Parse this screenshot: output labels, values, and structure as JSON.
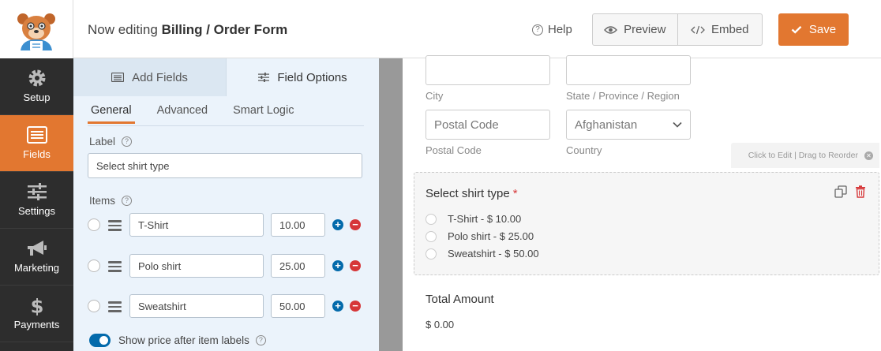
{
  "header": {
    "title_prefix": "Now editing",
    "form_name": "Billing / Order Form",
    "help_label": "Help",
    "preview_label": "Preview",
    "embed_label": "Embed",
    "save_label": "Save",
    "accent_color": "#e27730"
  },
  "nav": [
    {
      "label": "Setup",
      "icon": "gear-icon"
    },
    {
      "label": "Fields",
      "icon": "fields-icon",
      "active": true
    },
    {
      "label": "Settings",
      "icon": "sliders-icon"
    },
    {
      "label": "Marketing",
      "icon": "megaphone-icon"
    },
    {
      "label": "Payments",
      "icon": "dollar-icon"
    }
  ],
  "panel": {
    "tabs": {
      "add_fields": "Add Fields",
      "field_options": "Field Options"
    },
    "subtabs": {
      "general": "General",
      "advanced": "Advanced",
      "smart_logic": "Smart Logic"
    },
    "label_title": "Label",
    "label_value": "Select shirt type",
    "items_title": "Items",
    "items": [
      {
        "label": "T-Shirt",
        "price": "10.00"
      },
      {
        "label": "Polo shirt",
        "price": "25.00"
      },
      {
        "label": "Sweatshirt",
        "price": "50.00"
      }
    ],
    "toggle_label": "Show price after item labels"
  },
  "preview": {
    "city_label": "City",
    "state_label": "State / Province / Region",
    "postal_placeholder": "Postal Code",
    "postal_label": "Postal Code",
    "country_value": "Afghanistan",
    "country_label": "Country",
    "edit_hint": "Click to Edit | Drag to Reorder",
    "field_title": "Select shirt type",
    "required_mark": "*",
    "options": [
      "T-Shirt - $ 10.00",
      "Polo shirt - $ 25.00",
      "Sweatshirt - $ 50.00"
    ],
    "total_title": "Total Amount",
    "total_value": "$ 0.00"
  }
}
